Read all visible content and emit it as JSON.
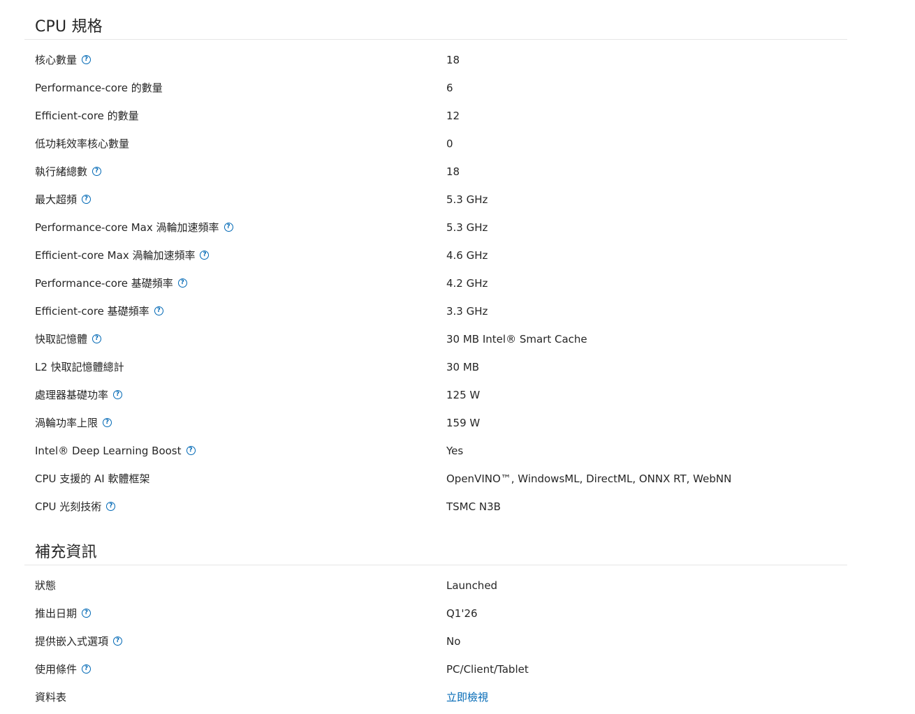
{
  "cpu_specs": {
    "title": "CPU 規格",
    "rows": [
      {
        "label": "核心數量",
        "value": "18",
        "help": true
      },
      {
        "label": "Performance-core 的數量",
        "value": "6",
        "help": false
      },
      {
        "label": "Efficient-core 的數量",
        "value": "12",
        "help": false
      },
      {
        "label": "低功耗效率核心數量",
        "value": "0",
        "help": false
      },
      {
        "label": "執行緒總數",
        "value": "18",
        "help": true
      },
      {
        "label": "最大超頻",
        "value": "5.3 GHz",
        "help": true
      },
      {
        "label": "Performance-core Max 渦輪加速頻率",
        "value": "5.3 GHz",
        "help": true
      },
      {
        "label": "Efficient-core Max 渦輪加速頻率",
        "value": "4.6 GHz",
        "help": true
      },
      {
        "label": "Performance-core 基礎頻率",
        "value": "4.2 GHz",
        "help": true
      },
      {
        "label": "Efficient-core 基礎頻率",
        "value": "3.3 GHz",
        "help": true
      },
      {
        "label": "快取記憶體",
        "value": "30 MB Intel® Smart Cache",
        "help": true
      },
      {
        "label": "L2 快取記憶體總計",
        "value": "30 MB",
        "help": false
      },
      {
        "label": "處理器基礎功率",
        "value": "125 W",
        "help": true
      },
      {
        "label": "渦輪功率上限",
        "value": "159 W",
        "help": true
      },
      {
        "label": "Intel® Deep Learning Boost",
        "value": "Yes",
        "help": true
      },
      {
        "label": "CPU 支援的 AI 軟體框架",
        "value": "OpenVINO™, WindowsML, DirectML, ONNX RT, WebNN",
        "help": false
      },
      {
        "label": "CPU 光刻技術",
        "value": "TSMC N3B",
        "help": true
      }
    ]
  },
  "supplemental": {
    "title": "補充資訊",
    "rows": [
      {
        "label": "狀態",
        "value": "Launched",
        "help": false
      },
      {
        "label": "推出日期",
        "value": "Q1'26",
        "help": true
      },
      {
        "label": "提供嵌入式選項",
        "value": "No",
        "help": true
      },
      {
        "label": "使用條件",
        "value": "PC/Client/Tablet",
        "help": true
      },
      {
        "label": "資料表",
        "value": "立即檢視",
        "help": false,
        "link": true
      }
    ]
  },
  "help_icon_glyph": "?",
  "colors": {
    "accent": "#0068b5",
    "text": "#262626",
    "divider": "#e6e6e6"
  }
}
